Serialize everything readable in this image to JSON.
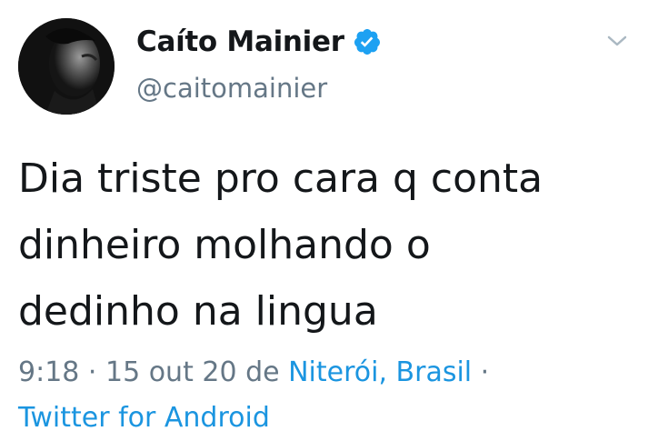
{
  "user": {
    "display_name": "Caíto Mainier",
    "handle": "@caitomainier",
    "avatar_icon": "profile-photo",
    "verified_icon": "verified-badge-icon"
  },
  "tweet": {
    "lines": [
      "Dia triste pro cara q conta",
      "dinheiro molhando o",
      "dedinho na lingua"
    ]
  },
  "meta": {
    "time": "9:18",
    "separator1": " · ",
    "date": "15 out 20 de ",
    "location": "Niterói, Brasil",
    "separator2": " ·",
    "source": "Twitter for Android"
  },
  "menu_icon": "chevron-down-icon",
  "colors": {
    "text": "#14171a",
    "secondary": "#657786",
    "link": "#1b95e0",
    "verified": "#1da1f2"
  }
}
